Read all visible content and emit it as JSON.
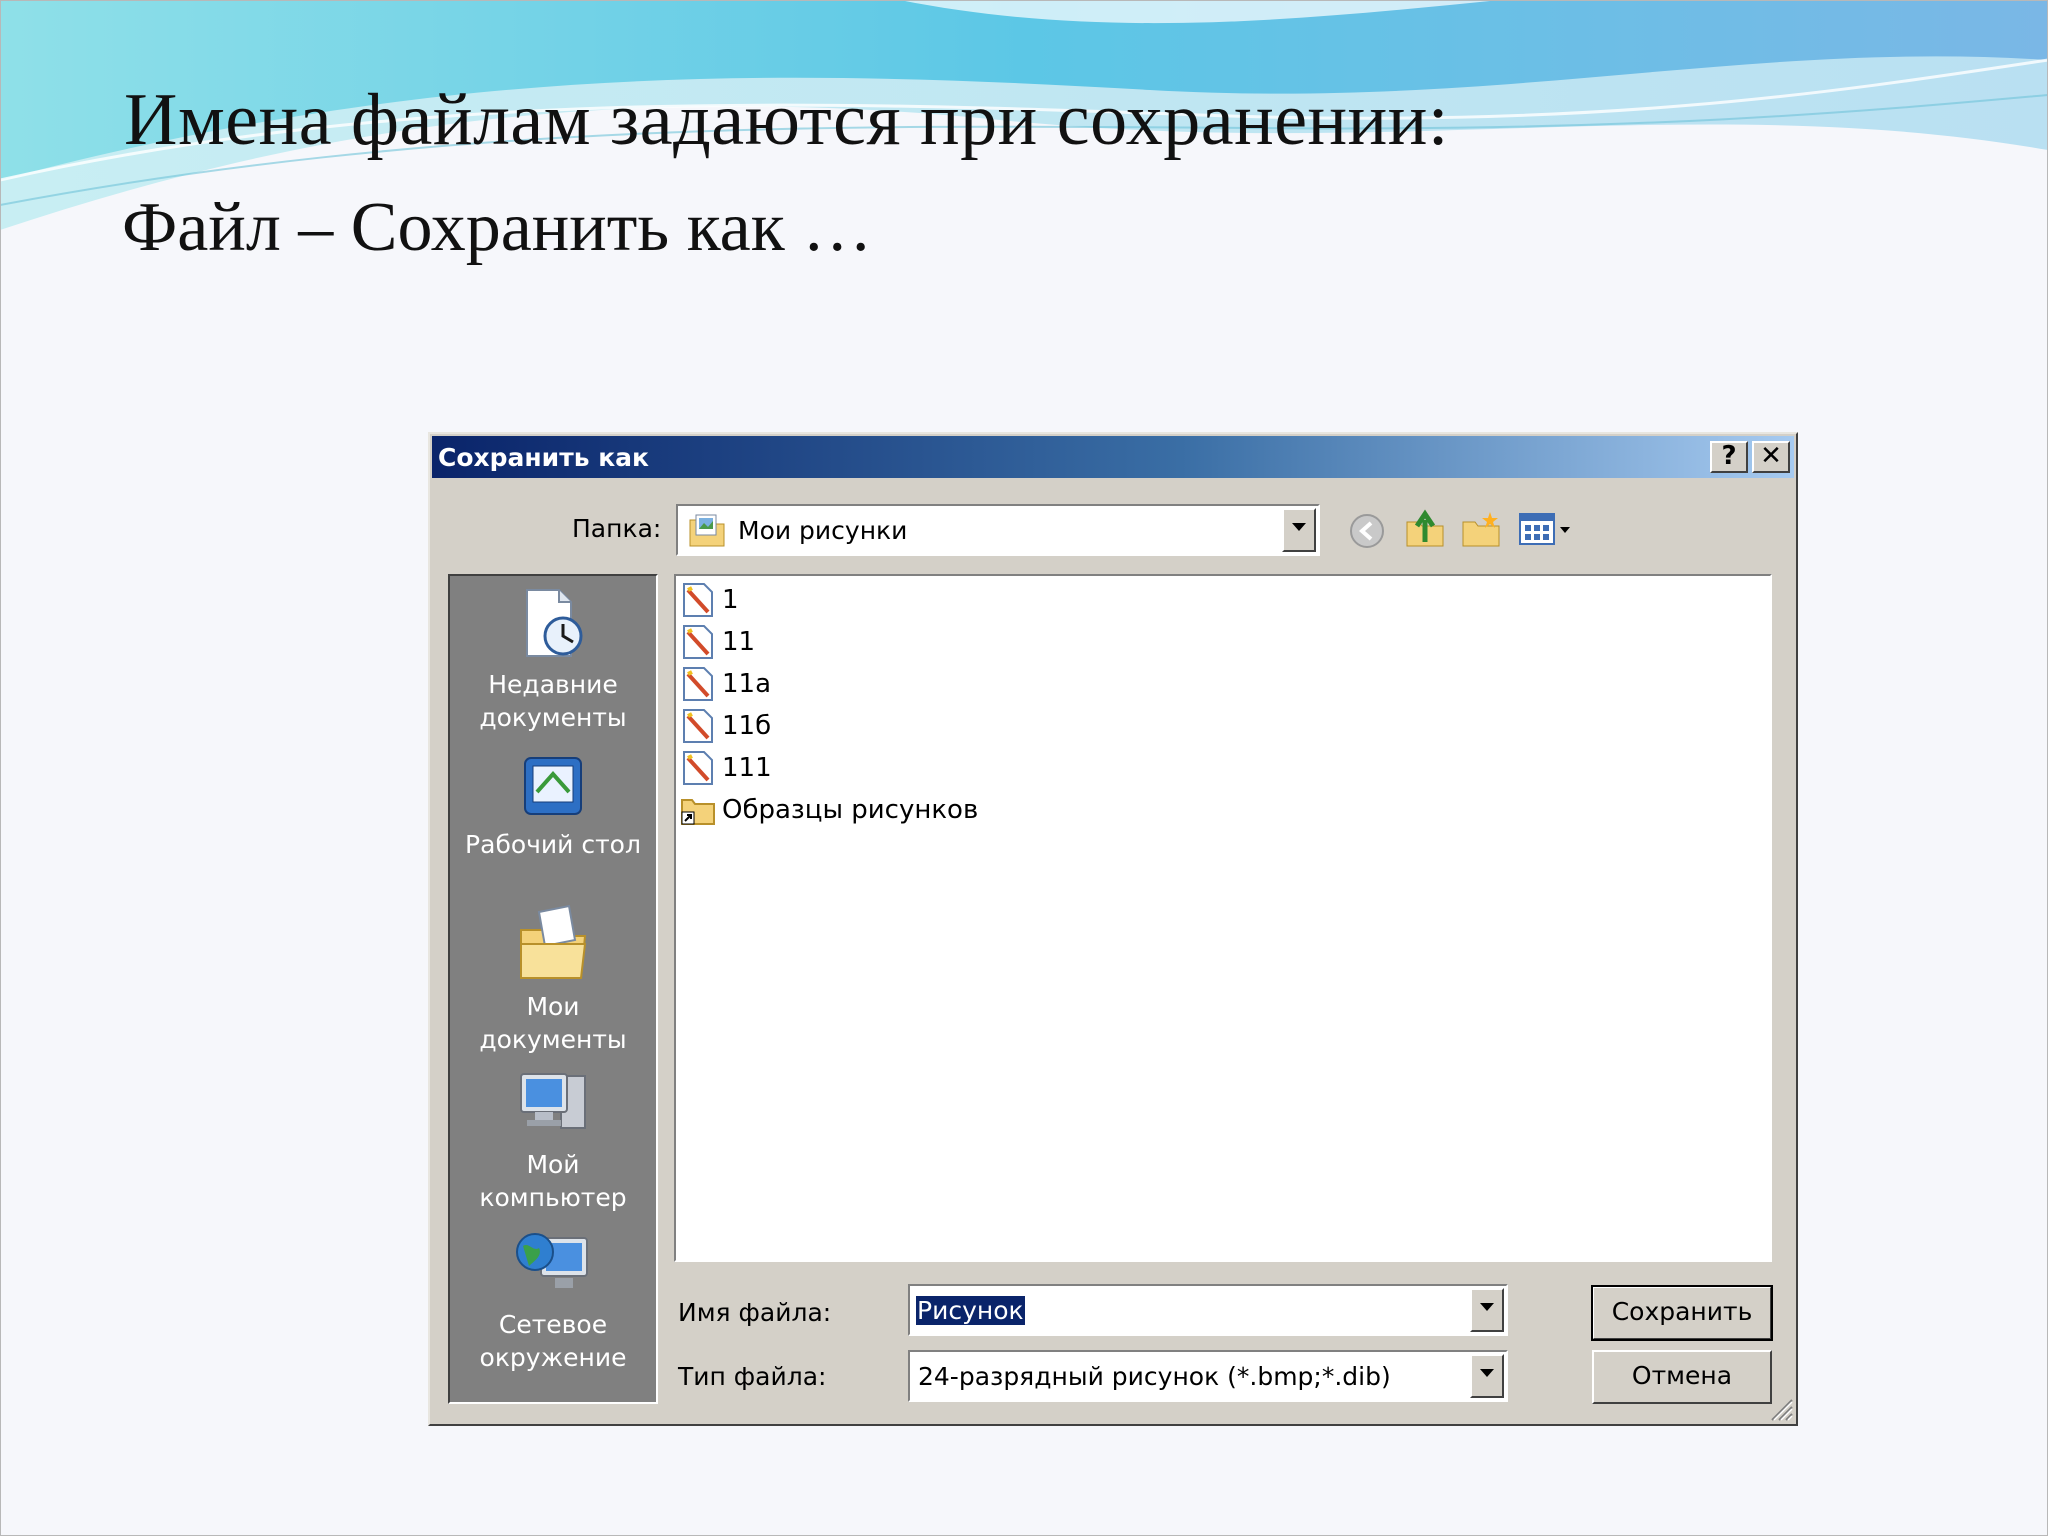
{
  "slide": {
    "title": "Имена файлам задаются при сохранении:",
    "subtitle": "Файл – Сохранить как …"
  },
  "dialog": {
    "title": "Сохранить как",
    "help_button": "?",
    "close_button": "✕",
    "folder_label": "Папка:",
    "folder_value": "Мои рисунки",
    "places": [
      {
        "label": "Недавние документы",
        "icon": "recent-documents-icon"
      },
      {
        "label": "Рабочий стол",
        "icon": "desktop-icon"
      },
      {
        "label": "Мои документы",
        "icon": "my-documents-icon"
      },
      {
        "label": "Мой компьютер",
        "icon": "my-computer-icon"
      },
      {
        "label": "Сетевое окружение",
        "icon": "network-icon"
      }
    ],
    "files": [
      {
        "name": "1",
        "type": "image"
      },
      {
        "name": "11",
        "type": "image"
      },
      {
        "name": "11a",
        "type": "image"
      },
      {
        "name": "11б",
        "type": "image"
      },
      {
        "name": "111",
        "type": "image"
      },
      {
        "name": "Образцы рисунков",
        "type": "folder-shortcut"
      }
    ],
    "filename_label": "Имя файла:",
    "filename_value": "Рисунок",
    "filetype_label": "Тип файла:",
    "filetype_value": "24-разрядный рисунок (*.bmp;*.dib)",
    "save_button": "Сохранить",
    "cancel_button": "Отмена"
  },
  "colors": {
    "titlebar_start": "#0a246a",
    "titlebar_end": "#a6caf0",
    "dialog_face": "#d4d0c8",
    "places_bar": "#808080",
    "selection": "#0a246a"
  }
}
